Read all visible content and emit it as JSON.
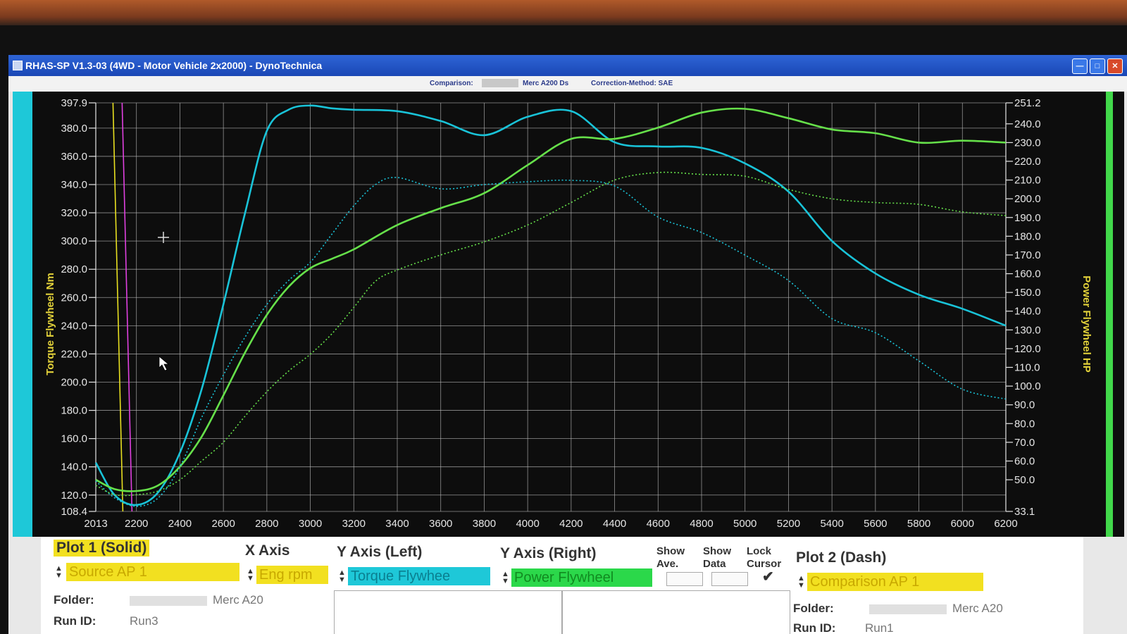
{
  "window": {
    "title": "RHAS-SP V1.3-03  (4WD - Motor Vehicle 2x2000) - DynoTechnica"
  },
  "comparison_bar": {
    "comparison_label": "Comparison:",
    "comparison_value": "Merc A200 Ds",
    "correction": "Correction-Method: SAE"
  },
  "colors": {
    "torque": "#19c3d8",
    "power": "#66e04a",
    "grid": "#bdbdbd",
    "axis_label": "#e3d23a",
    "cursor_yellow": "#e8e020",
    "cursor_magenta": "#e040e0"
  },
  "chart_data": {
    "type": "line",
    "xlabel": "",
    "ylabel_left": "Torque Flywheel Nm",
    "ylabel_right": "Power Flywheel HP",
    "x_ticks": [
      "2013",
      "2200",
      "2400",
      "2600",
      "2800",
      "3000",
      "3200",
      "3400",
      "3600",
      "3800",
      "4000",
      "4200",
      "4400",
      "4600",
      "4800",
      "5000",
      "5200",
      "5400",
      "5600",
      "5800",
      "6000",
      "6200"
    ],
    "left_ticks": [
      "397.9",
      "380.0",
      "360.0",
      "340.0",
      "320.0",
      "300.0",
      "280.0",
      "260.0",
      "240.0",
      "220.0",
      "200.0",
      "180.0",
      "160.0",
      "140.0",
      "120.0",
      "108.4"
    ],
    "right_ticks": [
      "251.2",
      "240.0",
      "230.0",
      "220.0",
      "210.0",
      "200.0",
      "190.0",
      "180.0",
      "170.0",
      "160.0",
      "150.0",
      "140.0",
      "130.0",
      "120.0",
      "110.0",
      "100.0",
      "90.0",
      "80.0",
      "70.0",
      "60.0",
      "50.0",
      "33.1"
    ],
    "xlim": [
      2013,
      6200
    ],
    "ylim_left": [
      108.4,
      397.9
    ],
    "ylim_right": [
      33.1,
      251.2
    ],
    "grid": true,
    "cursors_rpm": [
      2118,
      2160
    ],
    "series": [
      {
        "name": "Torque Flywheel",
        "plot": "Plot 1 (Solid)",
        "axis": "left",
        "style": "solid",
        "x": [
          2013,
          2100,
          2200,
          2300,
          2400,
          2500,
          2600,
          2700,
          2800,
          2900,
          3000,
          3100,
          3200,
          3400,
          3600,
          3800,
          4000,
          4200,
          4400,
          4600,
          4800,
          5000,
          5200,
          5400,
          5600,
          5800,
          6000,
          6200
        ],
        "y": [
          143,
          120,
          113,
          122,
          150,
          195,
          255,
          320,
          378,
          393,
          396,
          394,
          393,
          392,
          385,
          375,
          388,
          392,
          370,
          367,
          366,
          355,
          335,
          300,
          277,
          262,
          252,
          240
        ]
      },
      {
        "name": "Power Flywheel",
        "plot": "Plot 1 (Solid)",
        "axis": "right",
        "style": "solid",
        "x": [
          2013,
          2100,
          2200,
          2300,
          2400,
          2500,
          2600,
          2700,
          2800,
          2900,
          3000,
          3100,
          3200,
          3400,
          3600,
          3800,
          4000,
          4200,
          4400,
          4600,
          4800,
          5000,
          5200,
          5400,
          5600,
          5800,
          6000,
          6200
        ],
        "y": [
          50,
          45,
          44,
          47,
          57,
          73,
          95,
          118,
          138,
          153,
          163,
          168,
          173,
          186,
          195,
          203,
          218,
          232,
          232,
          238,
          246,
          248,
          243,
          237,
          235,
          230,
          231,
          230
        ]
      },
      {
        "name": "Torque Flywheel",
        "plot": "Plot 2 (Dash)",
        "axis": "left",
        "style": "dash",
        "x": [
          2013,
          2100,
          2200,
          2300,
          2400,
          2500,
          2600,
          2700,
          2800,
          2900,
          3000,
          3100,
          3200,
          3300,
          3400,
          3600,
          3800,
          4000,
          4200,
          4400,
          4600,
          4800,
          5000,
          5200,
          5400,
          5600,
          5800,
          6000,
          6200
        ],
        "y": [
          130,
          118,
          112,
          118,
          140,
          175,
          205,
          232,
          255,
          272,
          285,
          305,
          325,
          340,
          345,
          337,
          340,
          342,
          343,
          339,
          317,
          306,
          290,
          272,
          245,
          235,
          215,
          195,
          188
        ]
      },
      {
        "name": "Power Flywheel",
        "plot": "Plot 2 (Dash)",
        "axis": "right",
        "style": "dash",
        "x": [
          2013,
          2100,
          2200,
          2300,
          2400,
          2500,
          2600,
          2700,
          2800,
          2900,
          3000,
          3100,
          3200,
          3300,
          3400,
          3600,
          3800,
          4000,
          4200,
          4400,
          4600,
          4800,
          5000,
          5200,
          5400,
          5600,
          5800,
          6000,
          6200
        ],
        "y": [
          47,
          42,
          42,
          44,
          50,
          60,
          70,
          84,
          97,
          108,
          117,
          128,
          142,
          156,
          162,
          170,
          177,
          186,
          198,
          210,
          214,
          213,
          212,
          205,
          200,
          198,
          197,
          193,
          191
        ]
      }
    ]
  },
  "panel": {
    "plot1_title": "Plot 1 (Solid)",
    "plot1_source": "Source AP 1",
    "x_axis_title": "X Axis",
    "x_axis_value": "Eng rpm",
    "y_left_title": "Y Axis (Left)",
    "y_left_value": "Torque Flywhee",
    "y_right_title": "Y Axis (Right)",
    "y_right_value": "Power Flywheel",
    "show_ave": "Show\nAve.",
    "show_data": "Show\nData",
    "lock_cursor": "Lock\nCursor",
    "check_mark": "✔",
    "plot2_title": "Plot 2 (Dash)",
    "plot2_source": "Comparison AP 1",
    "folder_label": "Folder:",
    "folder1_value": "Merc A20",
    "folder2_value": "Merc A20",
    "runid_label": "Run ID:",
    "run1_value": "Run3",
    "run2_value": "Run1"
  }
}
